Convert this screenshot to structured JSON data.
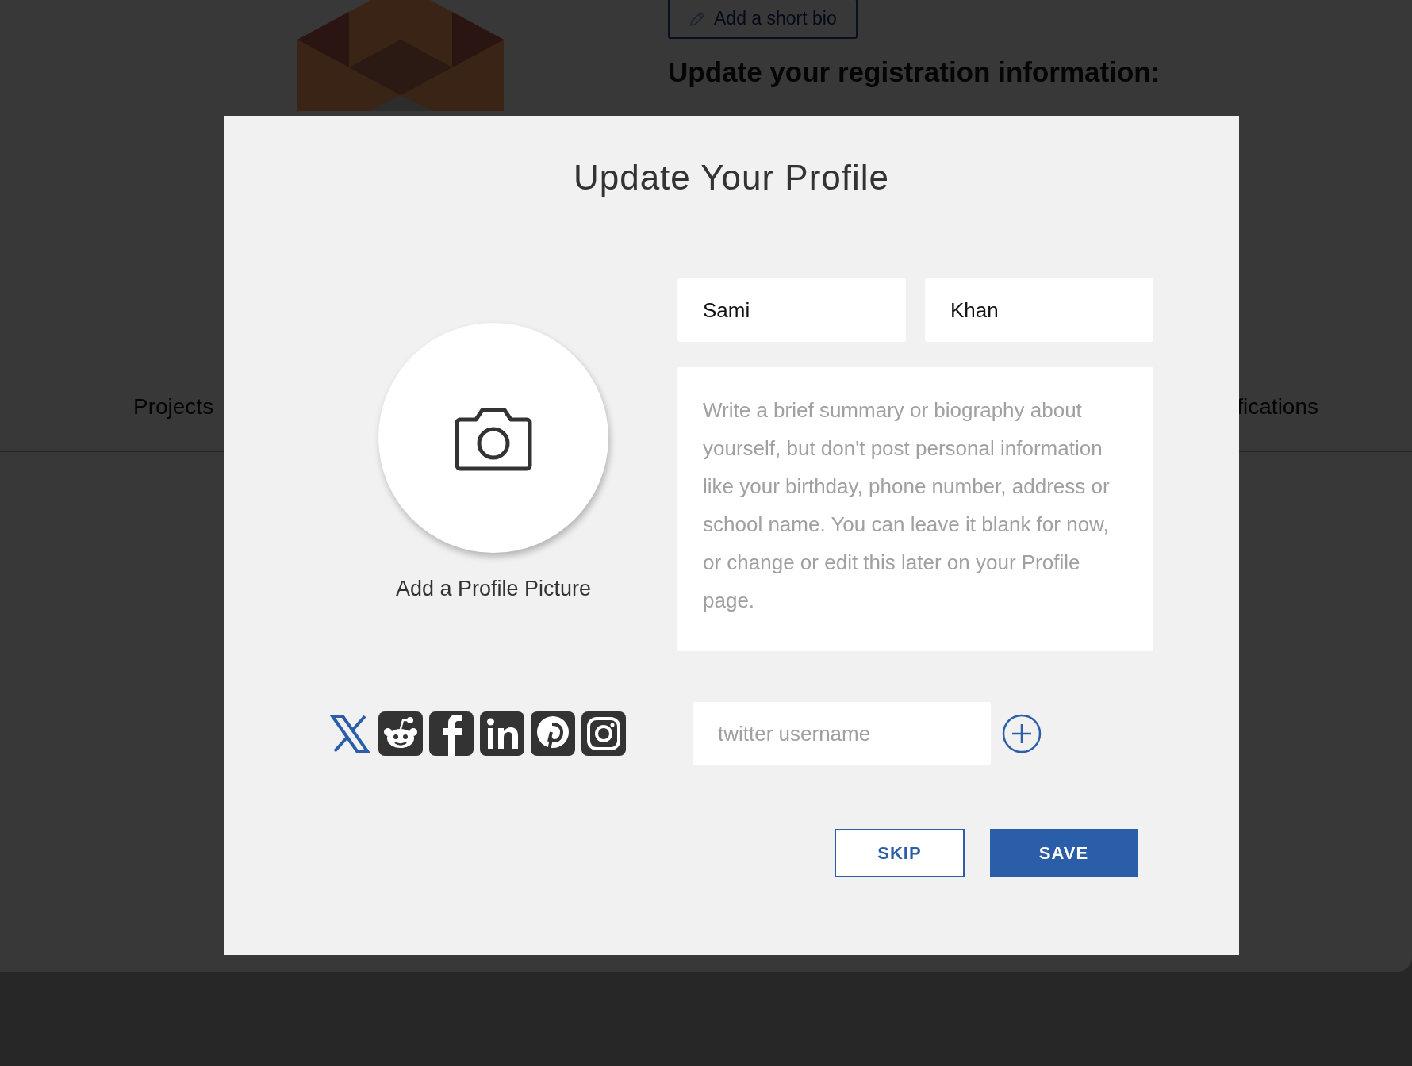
{
  "background": {
    "bio_button": "Add a short bio",
    "heading": "Update your registration information:",
    "tabs": [
      "Projects",
      "fications"
    ]
  },
  "modal": {
    "title": "Update Your Profile",
    "first_name": {
      "value": "Sami"
    },
    "last_name": {
      "value": "Khan"
    },
    "bio": {
      "placeholder": "Write a brief summary or biography about yourself, but don't post personal information like your birthday, phone number, address or school name. You can leave it blank for now, or change or edit this later on your Profile page."
    },
    "picture_label": "Add a Profile Picture",
    "social_networks": [
      {
        "kind": "x",
        "selected": true
      },
      {
        "kind": "reddit",
        "selected": false
      },
      {
        "kind": "facebook",
        "selected": false
      },
      {
        "kind": "linkedin",
        "selected": false
      },
      {
        "kind": "pinterest",
        "selected": false
      },
      {
        "kind": "instagram",
        "selected": false
      }
    ],
    "username_field": {
      "placeholder": "twitter username"
    },
    "buttons": [
      {
        "label": "SKIP",
        "kind": "secondary"
      },
      {
        "label": "SAVE",
        "kind": "primary"
      }
    ]
  }
}
